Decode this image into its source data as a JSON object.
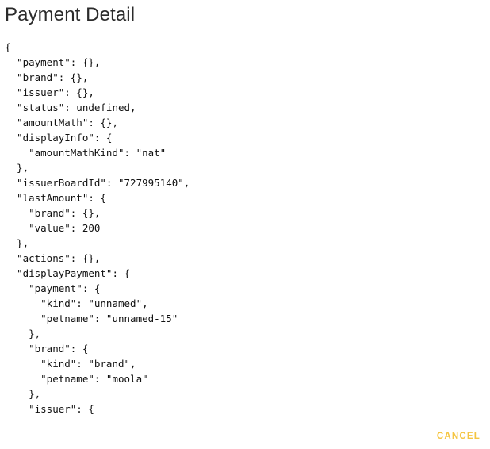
{
  "dialog": {
    "title": "Payment Detail",
    "cancel_label": "CANCEL"
  },
  "json_lines": [
    "{",
    "  \"payment\": {},",
    "  \"brand\": {},",
    "  \"issuer\": {},",
    "  \"status\": undefined,",
    "  \"amountMath\": {},",
    "  \"displayInfo\": {",
    "    \"amountMathKind\": \"nat\"",
    "  },",
    "  \"issuerBoardId\": \"727995140\",",
    "  \"lastAmount\": {",
    "    \"brand\": {},",
    "    \"value\": 200",
    "  },",
    "  \"actions\": {},",
    "  \"displayPayment\": {",
    "    \"payment\": {",
    "      \"kind\": \"unnamed\",",
    "      \"petname\": \"unnamed-15\"",
    "    },",
    "    \"brand\": {",
    "      \"kind\": \"brand\",",
    "      \"petname\": \"moola\"",
    "    },",
    "    \"issuer\": {"
  ],
  "colors": {
    "title_text": "#2b2b2b",
    "code_text": "#111111",
    "cancel_accent": "#f5c542",
    "background": "#ffffff"
  }
}
